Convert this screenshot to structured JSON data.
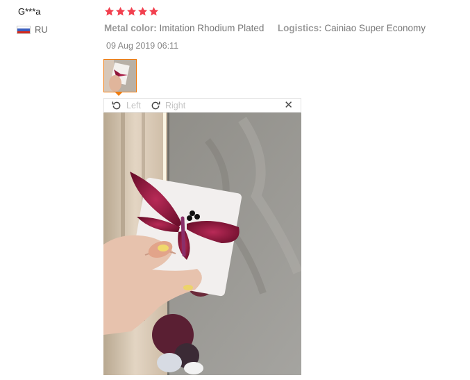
{
  "review": {
    "user_name": "G***a",
    "country_code": "RU",
    "rating": 5,
    "attributes": [
      {
        "label": "Metal color:",
        "value": "Imitation Rhodium Plated"
      },
      {
        "label": "Logistics:",
        "value": "Cainiao Super Economy"
      }
    ],
    "date": "09 Aug 2019 06:11"
  },
  "viewer": {
    "rotate_left_label": "Left",
    "rotate_right_label": "Right",
    "close_symbol": "✕",
    "icons": {
      "rotate_left": "rotate-left-icon",
      "rotate_right": "rotate-right-icon",
      "close": "close-icon"
    }
  },
  "colors": {
    "star": "#f2404f",
    "thumb_border": "#f07c0f",
    "label": "#9a9a9a"
  }
}
